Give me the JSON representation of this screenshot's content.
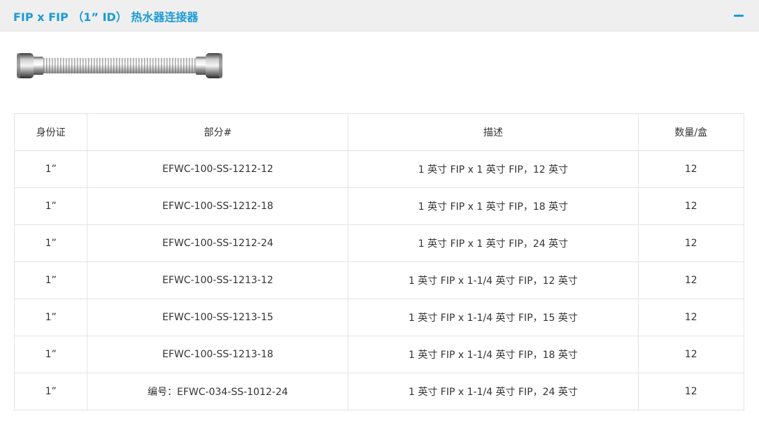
{
  "panel": {
    "title": "FIP x FIP （1” ID） 热水器连接器",
    "collapse_icon": "minus-icon",
    "accent_color": "#1a9bd7",
    "header_bg": "#efefef"
  },
  "product_image": {
    "icon": "flexible-stainless-connector-image"
  },
  "table": {
    "headers": [
      "身份证",
      "部分#",
      "描述",
      "数量/盒"
    ],
    "rows": [
      [
        "1”",
        "EFWC-100-SS-1212-12",
        "1 英寸 FIP x 1 英寸 FIP，12 英寸",
        "12"
      ],
      [
        "1”",
        "EFWC-100-SS-1212-18",
        "1 英寸 FIP x 1 英寸 FIP，18 英寸",
        "12"
      ],
      [
        "1”",
        "EFWC-100-SS-1212-24",
        "1 英寸 FIP x 1 英寸 FIP，24 英寸",
        "12"
      ],
      [
        "1”",
        "EFWC-100-SS-1213-12",
        "1 英寸 FIP x 1-1/4 英寸 FIP，12 英寸",
        "12"
      ],
      [
        "1”",
        "EFWC-100-SS-1213-15",
        "1 英寸 FIP x 1-1/4 英寸 FIP，15 英寸",
        "12"
      ],
      [
        "1”",
        "EFWC-100-SS-1213-18",
        "1 英寸 FIP x 1-1/4 英寸 FIP，18 英寸",
        "12"
      ],
      [
        "1”",
        "编号：EFWC-034-SS-1012-24",
        "1 英寸 FIP x 1-1/4 英寸 FIP，24 英寸",
        "12"
      ]
    ]
  }
}
